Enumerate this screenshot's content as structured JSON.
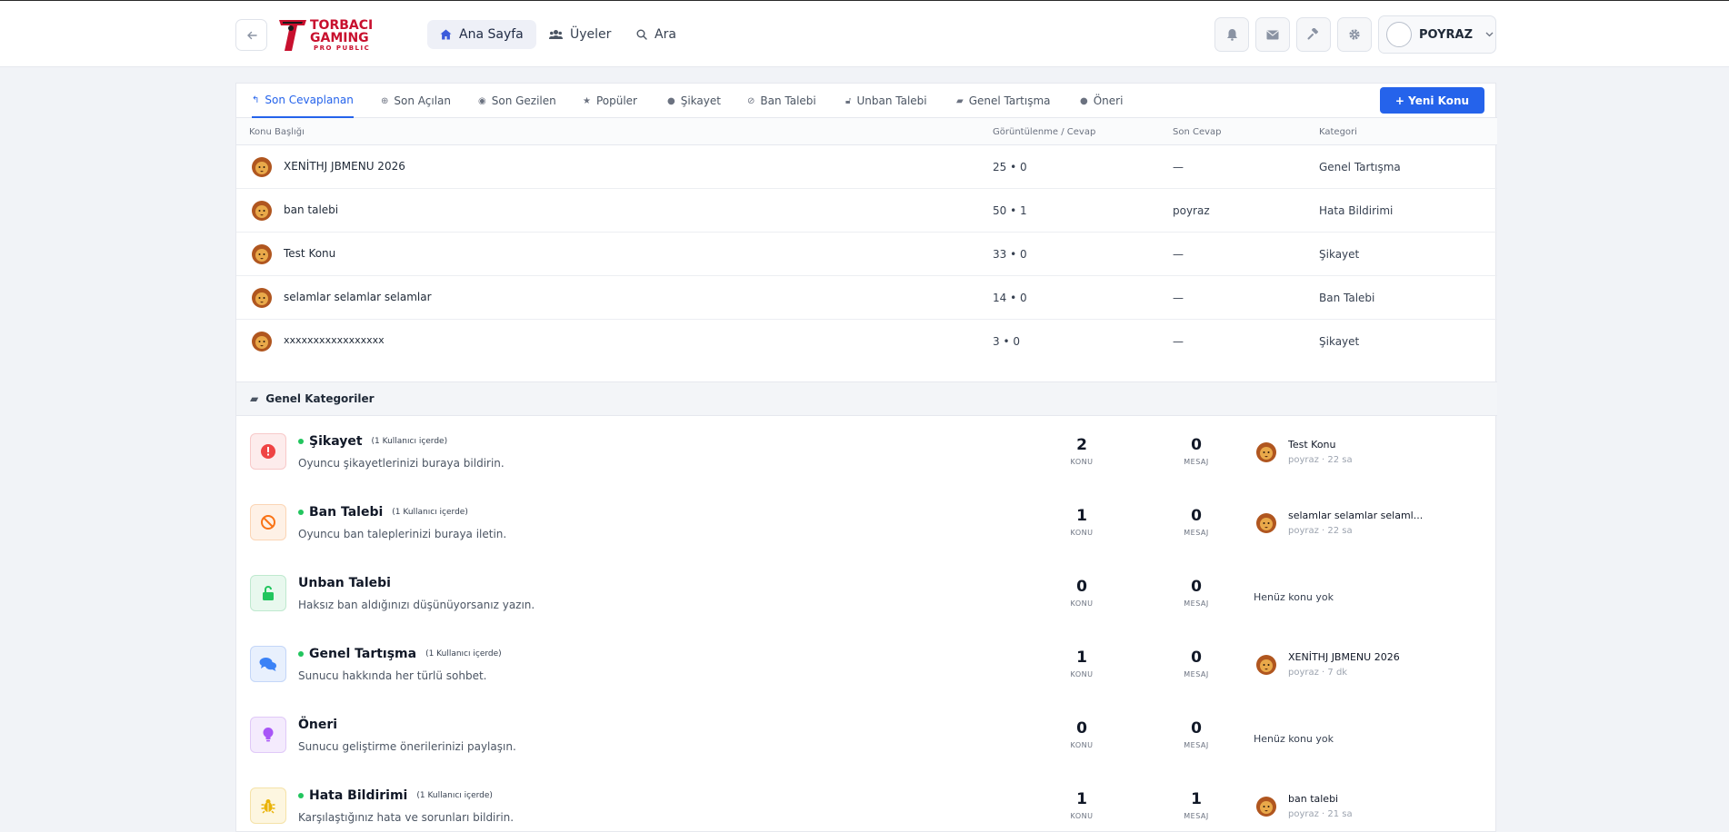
{
  "header": {
    "nav": [
      {
        "label": "Ana Sayfa",
        "icon": "home-icon"
      },
      {
        "label": "Üyeler",
        "icon": "users-icon"
      },
      {
        "label": "Ara",
        "icon": "search-icon"
      }
    ],
    "user": {
      "name": "POYRAZ"
    },
    "logo": {
      "line1": "TORBACI",
      "line2": "GAMING",
      "line3": "PRO PUBLIC"
    }
  },
  "tabs": [
    {
      "label": "Son Cevaplanan",
      "icon": "reply-icon"
    },
    {
      "label": "Son Açılan",
      "icon": "plus-circle-icon"
    },
    {
      "label": "Son Gezilen",
      "icon": "eye-icon"
    },
    {
      "label": "Popüler",
      "icon": "star-icon"
    },
    {
      "label": "Şikayet",
      "icon": "alert-icon"
    },
    {
      "label": "Ban Talebi",
      "icon": "ban-icon"
    },
    {
      "label": "Unban Talebi",
      "icon": "unlock-icon"
    },
    {
      "label": "Genel Tartışma",
      "icon": "comments-icon"
    },
    {
      "label": "Öneri",
      "icon": "bulb-icon"
    }
  ],
  "new_topic_label": "+ Yeni Konu",
  "table": {
    "headers": {
      "title": "Konu Başlığı",
      "views": "Görüntülenme / Cevap",
      "last": "Son Cevap",
      "category": "Kategori"
    },
    "rows": [
      {
        "title": "XENİTHJ JBMENU 2026",
        "views": "25  •  0",
        "last": "—",
        "category": "Genel Tartışma"
      },
      {
        "title": "ban talebi",
        "views": "50  •  1",
        "last": "poyraz",
        "category": "Hata Bildirimi"
      },
      {
        "title": "Test Konu",
        "views": "33  •  0",
        "last": "—",
        "category": "Şikayet"
      },
      {
        "title": "selamlar selamlar selamlar",
        "views": "14  •  0",
        "last": "—",
        "category": "Ban Talebi"
      },
      {
        "title": "xxxxxxxxxxxxxxxxx",
        "views": "3  •  0",
        "last": "—",
        "category": "Şikayet"
      }
    ]
  },
  "section_title": "Genel Kategoriler",
  "categories": [
    {
      "name": "Şikayet",
      "online": "(1 Kullanıcı içerde)",
      "desc": "Oyuncu şikayetlerinizi buraya bildirin.",
      "konu": "2",
      "mesaj": "0",
      "konu_label": "KONU",
      "mesaj_label": "MESAJ",
      "latest_title": "Test Konu",
      "latest_meta": "poyraz · 22 sa",
      "icon": "exclamation-circle-icon",
      "color": "#ef4444",
      "bg": "#fdecec"
    },
    {
      "name": "Ban Talebi",
      "online": "(1 Kullanıcı içerde)",
      "desc": "Oyuncu ban taleplerinizi buraya iletin.",
      "konu": "1",
      "mesaj": "0",
      "konu_label": "KONU",
      "mesaj_label": "MESAJ",
      "latest_title": "selamlar selamlar selaml...",
      "latest_meta": "poyraz · 22 sa",
      "icon": "ban-icon",
      "color": "#f97316",
      "bg": "#fef1e6"
    },
    {
      "name": "Unban Talebi",
      "online": "",
      "desc": "Haksız ban aldığınızı düşünüyorsanız yazın.",
      "konu": "0",
      "mesaj": "0",
      "konu_label": "KONU",
      "mesaj_label": "MESAJ",
      "empty": "Henüz konu yok",
      "icon": "unlock-icon",
      "color": "#22c55e",
      "bg": "#e8f8ee"
    },
    {
      "name": "Genel Tartışma",
      "online": "(1 Kullanıcı içerde)",
      "desc": "Sunucu hakkında her türlü sohbet.",
      "konu": "1",
      "mesaj": "0",
      "konu_label": "KONU",
      "mesaj_label": "MESAJ",
      "latest_title": "XENİTHJ JBMENU 2026",
      "latest_meta": "poyraz · 7 dk",
      "icon": "comments-icon",
      "color": "#3b82f6",
      "bg": "#e8f0fd"
    },
    {
      "name": "Öneri",
      "online": "",
      "desc": "Sunucu geliştirme önerilerinizi paylaşın.",
      "konu": "0",
      "mesaj": "0",
      "konu_label": "KONU",
      "mesaj_label": "MESAJ",
      "empty": "Henüz konu yok",
      "icon": "bulb-icon",
      "color": "#a855f7",
      "bg": "#f4ebfd"
    },
    {
      "name": "Hata Bildirimi",
      "online": "(1 Kullanıcı içerde)",
      "desc": "Karşılaştığınız hata ve sorunları bildirin.",
      "konu": "1",
      "mesaj": "1",
      "konu_label": "KONU",
      "mesaj_label": "MESAJ",
      "latest_title": "ban talebi",
      "latest_meta": "poyraz · 21 sa",
      "icon": "bug-icon",
      "color": "#eab308",
      "bg": "#fdf6e0"
    }
  ]
}
